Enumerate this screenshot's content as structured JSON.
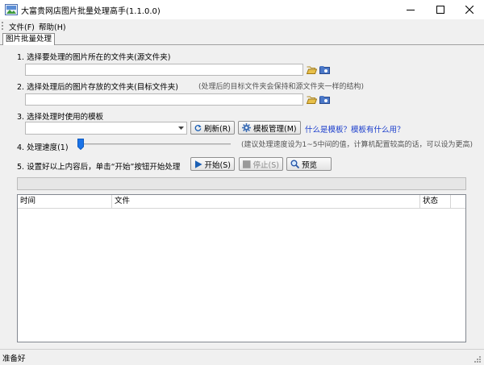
{
  "window": {
    "title": "大富贵网店图片批量处理高手(1.1.0.0)",
    "icon": "app-icon",
    "controls": [
      "minimize-icon",
      "maximize-icon",
      "close-icon"
    ]
  },
  "menu": {
    "file": "文件(F)",
    "help": "帮助(H)"
  },
  "tab": {
    "label": "图片批量处理"
  },
  "steps": {
    "source": {
      "label": "1. 选择要处理的图片所在的文件夹(源文件夹)",
      "value": ""
    },
    "target": {
      "label": "2. 选择处理后的图片存放的文件夹(目标文件夹)",
      "hint": "(处理后的目标文件夹会保持和源文件夹一样的结构)",
      "value": ""
    },
    "template": {
      "label": "3. 选择处理时使用的模板",
      "selected": "",
      "refresh_label": "刷新(R)",
      "manage_label": "模板管理(M)",
      "help_link": "什么是模板？模板有什么用？"
    },
    "speed": {
      "label": "4. 处理速度(1)",
      "value": 1,
      "min": 1,
      "max": 5,
      "hint": "(建议处理速度设为1~5中间的值，计算机配置较高的话，可以设为更高)"
    },
    "run": {
      "label": "5. 设置好以上内容后，单击“开始”按钮开始处理",
      "start_label": "开始(S)",
      "stop_label": "停止(S)",
      "preview_label": "预览"
    }
  },
  "progress": {
    "value": 0
  },
  "log_table": {
    "columns": [
      "时间",
      "文件",
      "状态"
    ],
    "rows": []
  },
  "status": {
    "text": "准备好"
  },
  "colors": {
    "panel_bg": "#f0f0f0",
    "link": "#1a3dcc",
    "play_icon": "#1a5fb4"
  }
}
